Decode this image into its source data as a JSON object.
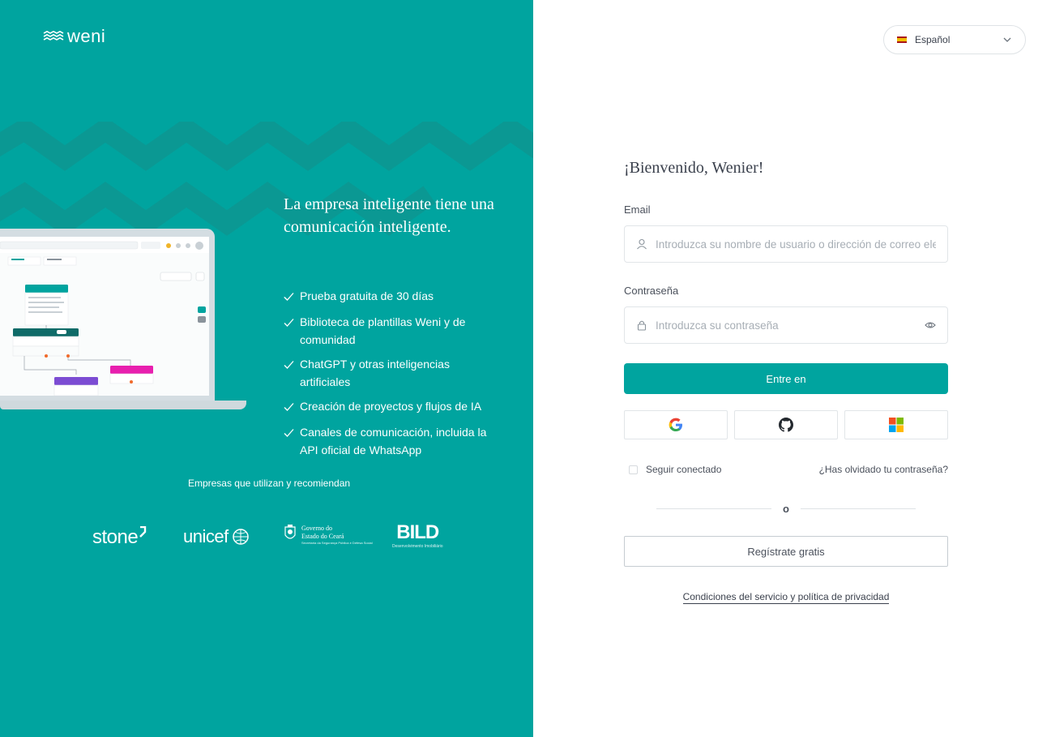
{
  "brand": {
    "logo_text": "weni",
    "accent_color": "#00a49f"
  },
  "left_panel": {
    "headline": "La empresa inteligente tiene una comunicación inteligente.",
    "features": [
      "Prueba gratuita de 30 días",
      "Biblioteca de plantillas Weni y de comunidad",
      "ChatGPT y otras inteligencias artificiales",
      "Creación de proyectos y flujos de IA",
      "Canales de comunicación, incluida la API oficial de WhatsApp"
    ],
    "companies_title": "Empresas que utilizan y recomiendan",
    "companies": {
      "stone": "stone",
      "unicef": "unicef",
      "ceara_line1": "Governo do",
      "ceara_line2": "Estado do Ceará",
      "ceara_sub": "Secretaria da Segurança Pública e Defesa Social",
      "bild": "BILD",
      "bild_sub": "Desenvolvimento Imobiliário"
    }
  },
  "language": {
    "selected": "Español"
  },
  "login": {
    "welcome": "¡Bienvenido, Wenier!",
    "email_label": "Email",
    "email_placeholder": "Introduzca su nombre de usuario o dirección de correo electrónico",
    "password_label": "Contraseña",
    "password_placeholder": "Introduzca su contraseña",
    "submit_label": "Entre en",
    "social_providers": [
      "google-icon",
      "github-icon",
      "microsoft-icon"
    ],
    "remember_label": "Seguir conectado",
    "forgot_label": "¿Has olvidado tu contraseña?",
    "divider_label": "o",
    "register_label": "Regístrate gratis",
    "terms_label": "Condiciones del servicio y política de privacidad"
  }
}
